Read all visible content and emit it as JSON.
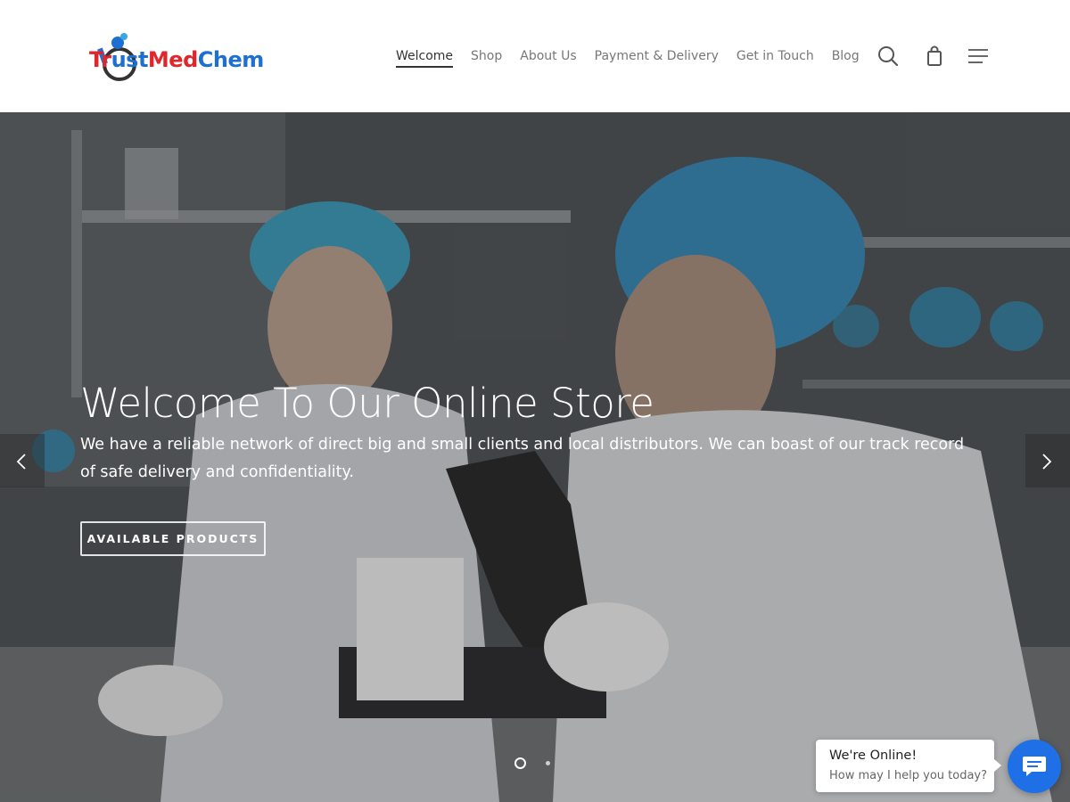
{
  "brand": {
    "logo_parts": [
      "Tr",
      "ust",
      "Med",
      "Chem"
    ],
    "logo_colors": [
      "#e0262b",
      "#1d6fd1"
    ]
  },
  "nav": {
    "items": [
      {
        "label": "Welcome",
        "active": true
      },
      {
        "label": "Shop"
      },
      {
        "label": "About Us"
      },
      {
        "label": "Payment & Delivery"
      },
      {
        "label": "Get in Touch"
      },
      {
        "label": "Blog"
      }
    ],
    "icons": [
      "search-icon",
      "shopping-bag-icon",
      "menu-icon"
    ]
  },
  "hero": {
    "title": "Welcome To Our Online Store",
    "description": "We have a reliable network of direct big and small clients and local distributors. We can boast of our track record of safe delivery and confidentiality.",
    "button_label": "AVAILABLE PRODUCTS",
    "slides_total": 2,
    "slide_active": 1
  },
  "chat": {
    "title": "We're Online!",
    "subtitle": "How may I help you today?",
    "accent": "#1f6fe6"
  }
}
